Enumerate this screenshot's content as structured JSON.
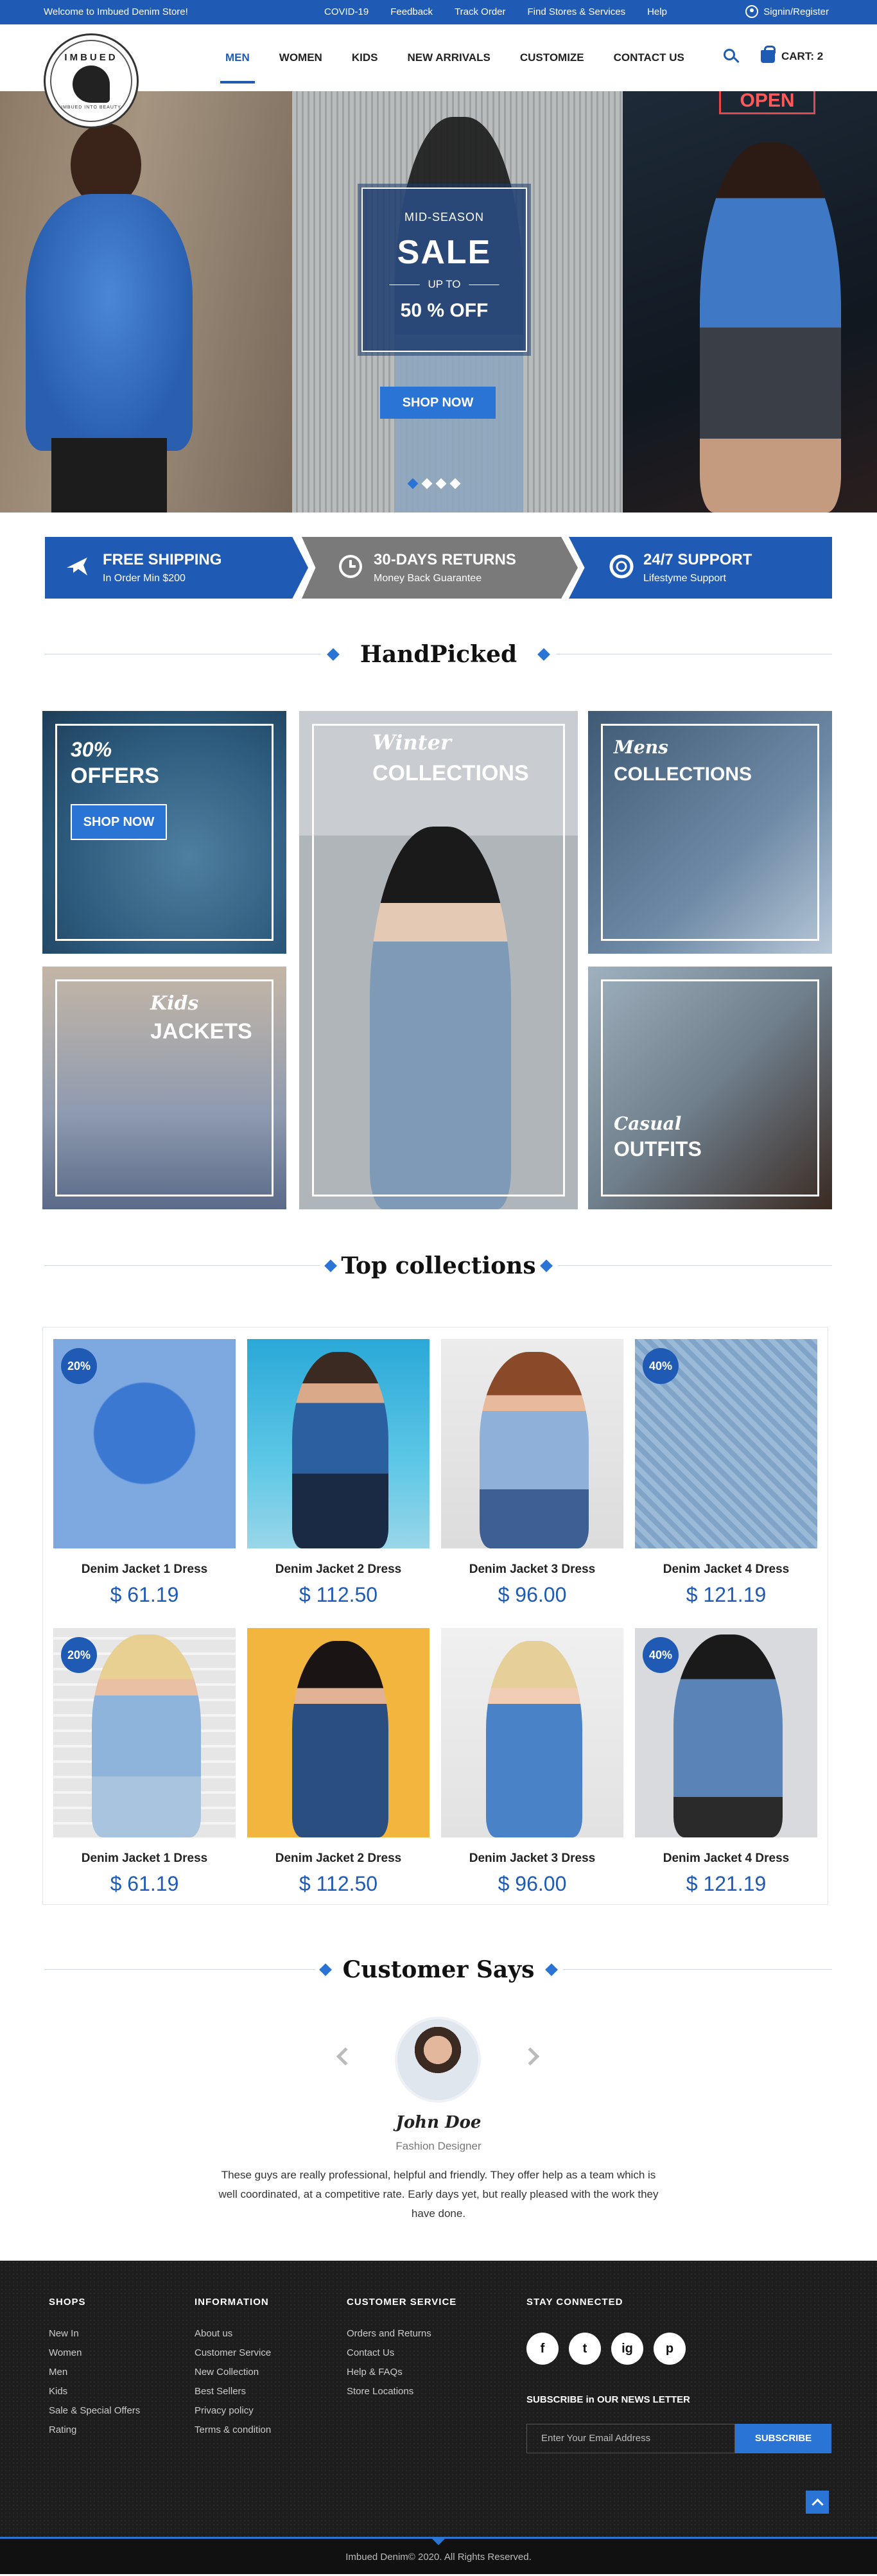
{
  "topbar": {
    "welcome": "Welcome to Imbued Denim Store!",
    "links": [
      "COVID-19",
      "Feedback",
      "Track Order",
      "Find Stores & Services",
      "Help"
    ],
    "account": "Signin/Register"
  },
  "logo": {
    "brand": "IMBUED",
    "tagline": "IMBUED INTO BEAUTY"
  },
  "nav": {
    "items": [
      "MEN",
      "WOMEN",
      "KIDS",
      "NEW ARRIVALS",
      "CUSTOMIZE",
      "CONTACT US"
    ],
    "active": "MEN",
    "cart": "CART: 2"
  },
  "hero": {
    "kicker": "MID-SEASON",
    "title": "SALE",
    "upto": "UP TO",
    "discount": "50 % OFF",
    "cta": "SHOP NOW",
    "neon": "OPEN",
    "slide_count": 4,
    "active_slide": 1
  },
  "features": [
    {
      "title": "FREE SHIPPING",
      "subtitle": "In Order Min $200",
      "icon": "airplane-icon"
    },
    {
      "title": "30-DAYS RETURNS",
      "subtitle": "Money Back  Guarantee",
      "icon": "clock-icon"
    },
    {
      "title": "24/7 SUPPORT",
      "subtitle": "Lifestyme Support",
      "icon": "lifebuoy-icon"
    }
  ],
  "handpicked": {
    "heading": "HandPicked",
    "offers": {
      "pct": "30%",
      "label": "OFFERS",
      "cta": "SHOP NOW"
    },
    "winter": {
      "italic": "Winter",
      "label": "COLLECTIONS"
    },
    "mens": {
      "italic": "Mens",
      "label": "COLLECTIONS"
    },
    "kids": {
      "italic": "Kids",
      "label": "JACKETS"
    },
    "casual": {
      "italic": "Casual",
      "label": "OUTFITS"
    }
  },
  "top_collections": {
    "heading": "Top collections",
    "products": [
      {
        "name": "Denim Jacket 1 Dress",
        "price": "$ 61.19",
        "badge": "20%"
      },
      {
        "name": "Denim Jacket 2 Dress",
        "price": "$ 112.50",
        "badge": ""
      },
      {
        "name": "Denim Jacket 3 Dress",
        "price": "$ 96.00",
        "badge": ""
      },
      {
        "name": "Denim Jacket 4 Dress",
        "price": "$ 121.19",
        "badge": "40%"
      },
      {
        "name": "Denim Jacket 1 Dress",
        "price": "$ 61.19",
        "badge": "20%"
      },
      {
        "name": "Denim Jacket 2 Dress",
        "price": "$ 112.50",
        "badge": ""
      },
      {
        "name": "Denim Jacket 3 Dress",
        "price": "$ 96.00",
        "badge": ""
      },
      {
        "name": "Denim Jacket 4 Dress",
        "price": "$ 121.19",
        "badge": "40%"
      }
    ]
  },
  "testimonial": {
    "heading": "Customer Says",
    "name": "John Doe",
    "role": "Fashion Designer",
    "quote": "These guys are really professional, helpful and friendly.  They offer help as a team which is well coordinated, at a competitive rate. Early days yet, but really pleased with the work they have done."
  },
  "footer": {
    "shops": {
      "title": "SHOPS",
      "links": [
        "New In",
        "Women",
        "Men",
        "Kids",
        "Sale & Special Offers",
        "Rating"
      ]
    },
    "information": {
      "title": "INFORMATION",
      "links": [
        "About us",
        "Customer Service",
        "New Collection",
        "Best Sellers",
        "Privacy policy",
        "Terms & condition"
      ]
    },
    "customer_service": {
      "title": "CUSTOMER SERVICE",
      "links": [
        "Orders and Returns",
        "Contact Us",
        "Help & FAQs",
        "Store Locations"
      ]
    },
    "stay_connected": {
      "title": "STAY CONNECTED",
      "social": [
        "f",
        "t",
        "ig",
        "p"
      ]
    },
    "subscribe_heading": "SUBSCRIBE in OUR NEWS LETTER",
    "email_placeholder": "Enter Your Email Address",
    "subscribe_button": "SUBSCRIBE",
    "copyright": "Imbued Denim© 2020. All Rights Reserved."
  },
  "colors": {
    "primary": "#1f5bb5",
    "accent": "#2a74d5",
    "footer_bg": "#1d1d1d"
  }
}
